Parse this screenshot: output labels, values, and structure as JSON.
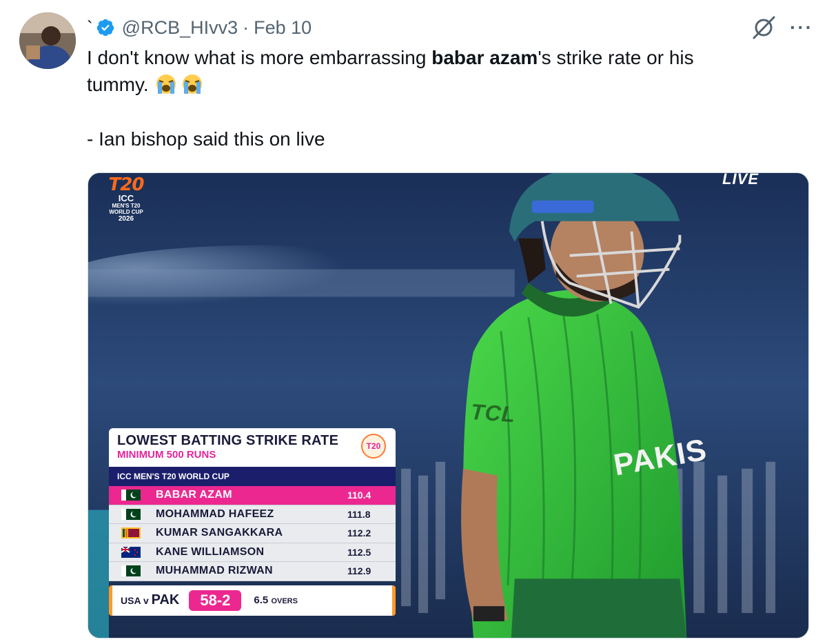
{
  "tweet": {
    "display_name": "`",
    "handle": "@RCB_HIvv3",
    "separator": "·",
    "date": "Feb 10",
    "more_label": "···",
    "text_part1": "I don't know what is more embarrassing ",
    "text_bold": "babar azam",
    "text_part2": "'s strike rate or his",
    "text_line2": "tummy.",
    "text_line3": "- Ian bishop said this on live"
  },
  "media": {
    "logo_t20": "T20",
    "logo_icc": "ICC",
    "logo_line1": "MEN'S T20",
    "logo_line2": "WORLD CUP",
    "logo_year": "2026",
    "live_label": "LIVE",
    "shirt_sponsor": "TCL",
    "shirt_name": "PAKIS",
    "graphic": {
      "title": "LOWEST BATTING STRIKE RATE",
      "subtitle": "MINIMUM 500 RUNS",
      "badge": "T20",
      "tournament": "ICC MEN'S T20 WORLD CUP",
      "rows": [
        {
          "name": "BABAR AZAM",
          "sr": "110.4",
          "flag": "pakistan"
        },
        {
          "name": "MOHAMMAD HAFEEZ",
          "sr": "111.8",
          "flag": "pakistan"
        },
        {
          "name": "KUMAR SANGAKKARA",
          "sr": "112.2",
          "flag": "sri-lanka"
        },
        {
          "name": "KANE WILLIAMSON",
          "sr": "112.5",
          "flag": "new-zealand"
        },
        {
          "name": "MUHAMMAD RIZWAN",
          "sr": "112.9",
          "flag": "pakistan"
        }
      ],
      "score_team1": "USA",
      "score_v": "v",
      "score_team2": "PAK",
      "score_runs": "58-2",
      "score_overs": "6.5",
      "score_overs_label": "OVERS"
    }
  },
  "colors": {
    "verified": "#1d9bf0",
    "highlight": "#ec2890",
    "tournament_bar": "#1b1f6b",
    "jersey": "#35c23a"
  }
}
